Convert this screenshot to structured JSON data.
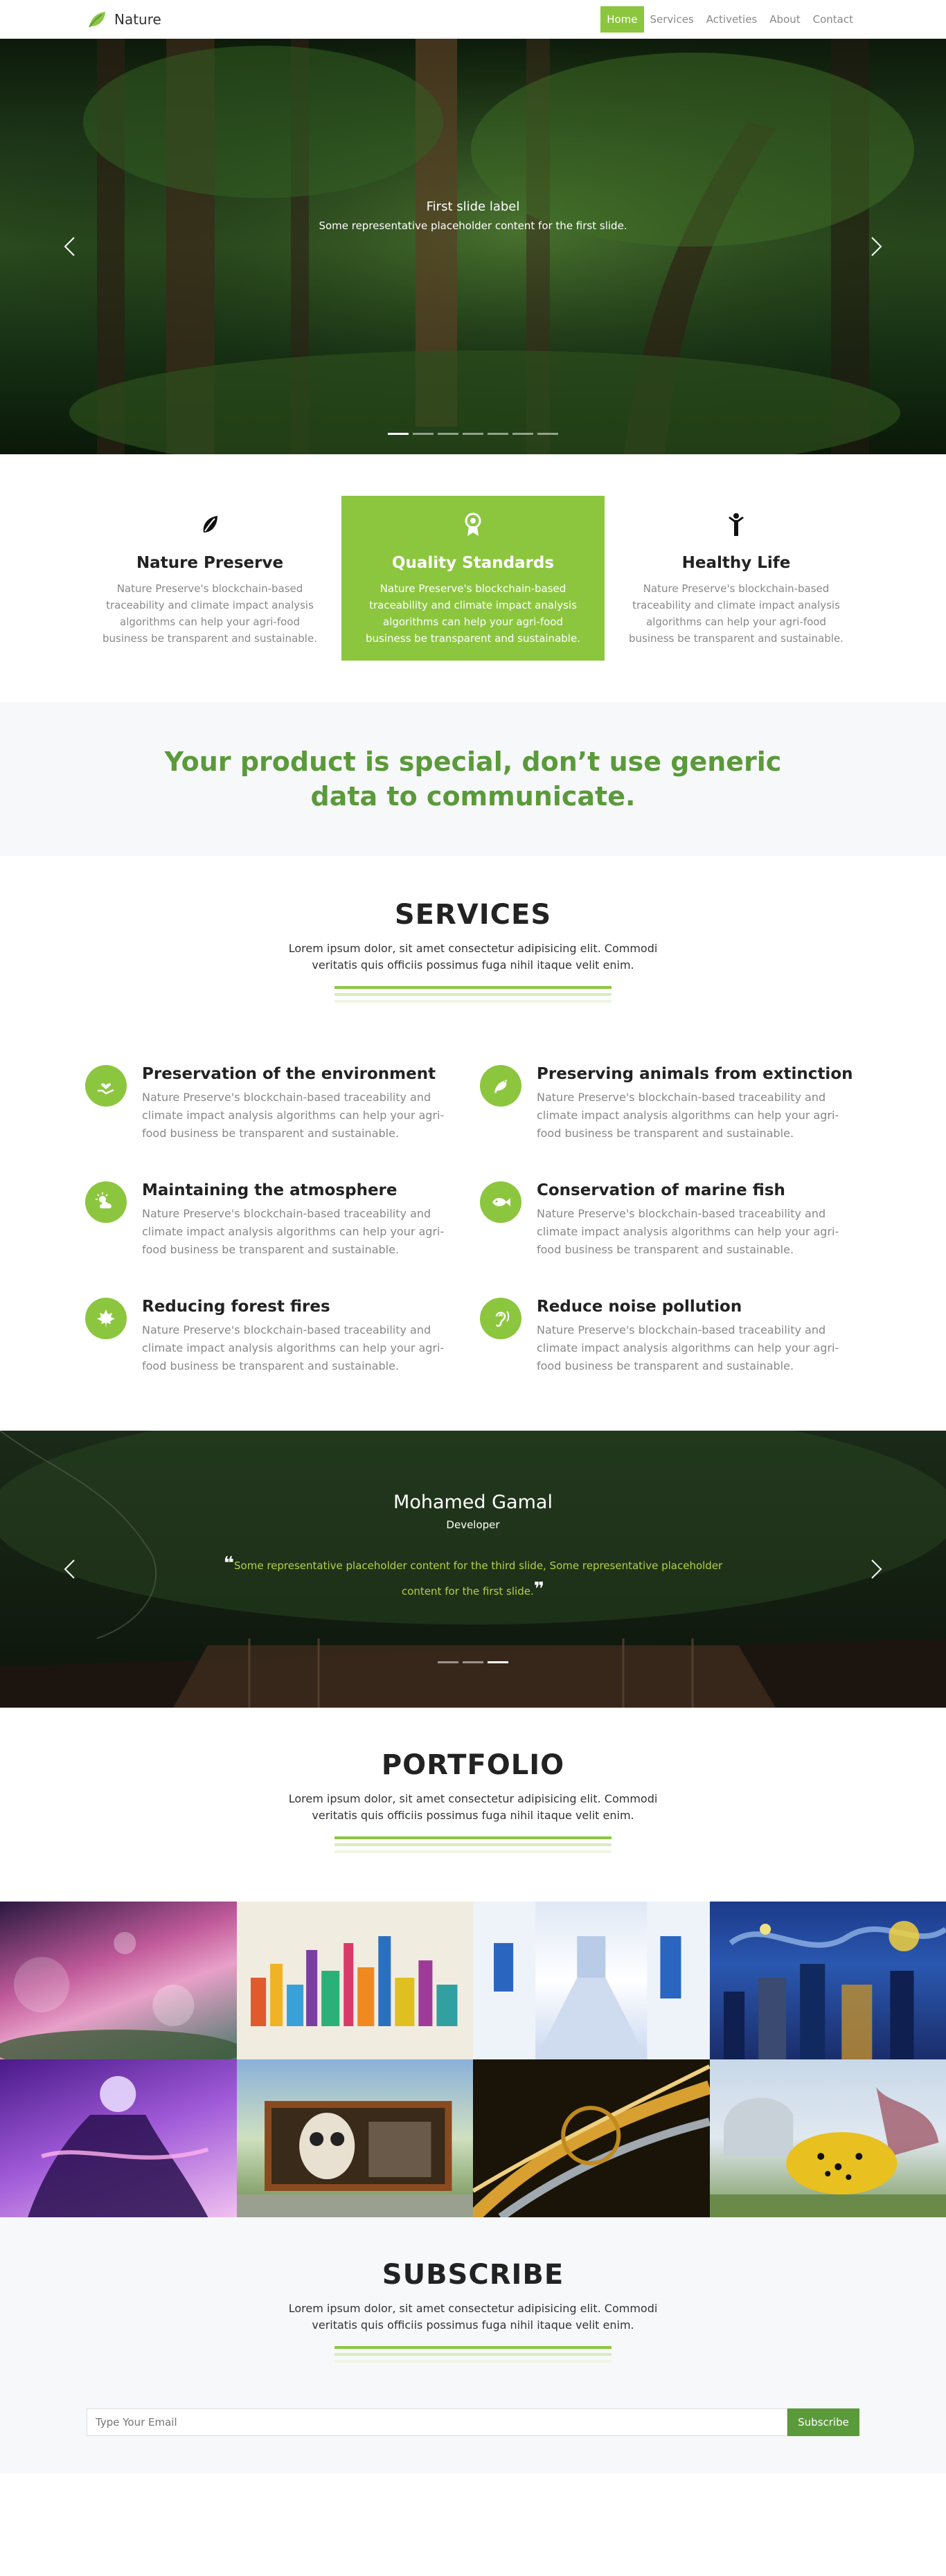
{
  "nav": {
    "brand": "Nature",
    "links": [
      "Home",
      "Services",
      "Activeties",
      "About",
      "Contact"
    ]
  },
  "hero": {
    "title": "First slide label",
    "text": "Some representative placeholder content for the first slide.",
    "slides": 7,
    "active_slide": 1
  },
  "features": [
    {
      "icon": "leaf-icon",
      "title": "Nature Preserve",
      "text": "Nature Preserve's blockchain-based traceability and climate impact analysis algorithms can help your agri-food business be transparent and sustainable."
    },
    {
      "icon": "award-icon",
      "title": "Quality Standards",
      "text": "Nature Preserve's blockchain-based traceability and climate impact analysis algorithms can help your agri-food business be transparent and sustainable."
    },
    {
      "icon": "person-icon",
      "title": "Healthy Life",
      "text": "Nature Preserve's blockchain-based traceability and climate impact analysis algorithms can help your agri-food business be transparent and sustainable."
    }
  ],
  "banner": {
    "text": "Your product is special, don’t use generic data to communicate."
  },
  "services": {
    "title": "SERVICES",
    "subtitle": "Lorem ipsum dolor, sit amet consectetur adipisicing elit. Commodi veritatis quis officiis possimus fuga nihil itaque velit enim.",
    "items": [
      {
        "icon": "hand-heart-icon",
        "title": "Preservation of the environment",
        "text": "Nature Preserve's blockchain-based traceability and climate impact analysis algorithms can help your agri-food business be transparent and sustainable."
      },
      {
        "icon": "bird-icon",
        "title": "Preserving animals from extinction",
        "text": "Nature Preserve's blockchain-based traceability and climate impact analysis algorithms can help your agri-food business be transparent and sustainable."
      },
      {
        "icon": "sun-cloud-icon",
        "title": "Maintaining the atmosphere",
        "text": "Nature Preserve's blockchain-based traceability and climate impact analysis algorithms can help your agri-food business be transparent and sustainable."
      },
      {
        "icon": "fish-icon",
        "title": "Conservation of marine fish",
        "text": "Nature Preserve's blockchain-based traceability and climate impact analysis algorithms can help your agri-food business be transparent and sustainable."
      },
      {
        "icon": "maple-leaf-icon",
        "title": "Reducing forest fires",
        "text": "Nature Preserve's blockchain-based traceability and climate impact analysis algorithms can help your agri-food business be transparent and sustainable."
      },
      {
        "icon": "ear-icon",
        "title": "Reduce noise pollution",
        "text": "Nature Preserve's blockchain-based traceability and climate impact analysis algorithms can help your agri-food business be transparent and sustainable."
      }
    ]
  },
  "testimonial": {
    "name": "Mohamed Gamal",
    "role": "Developer",
    "quote": "Some representative placeholder content for the third slide, Some representative placeholder content for the first slide.",
    "slides": 3,
    "active_slide": 3
  },
  "portfolio": {
    "title": "PORTFOLIO",
    "subtitle": "Lorem ipsum dolor, sit amet consectetur adipisicing elit. Commodi veritatis quis officiis possimus fuga nihil itaque velit enim."
  },
  "subscribe": {
    "title": "SUBSCRIBE",
    "subtitle": "Lorem ipsum dolor, sit amet consectetur adipisicing elit. Commodi veritatis quis officiis possimus fuga nihil itaque velit enim.",
    "placeholder": "Type Your Email",
    "button": "Subscribe"
  },
  "colors": {
    "accent": "#8cc63f",
    "accent_dark": "#5a9a3a",
    "muted_text": "#888888",
    "section_bg": "#f7f8fa"
  }
}
